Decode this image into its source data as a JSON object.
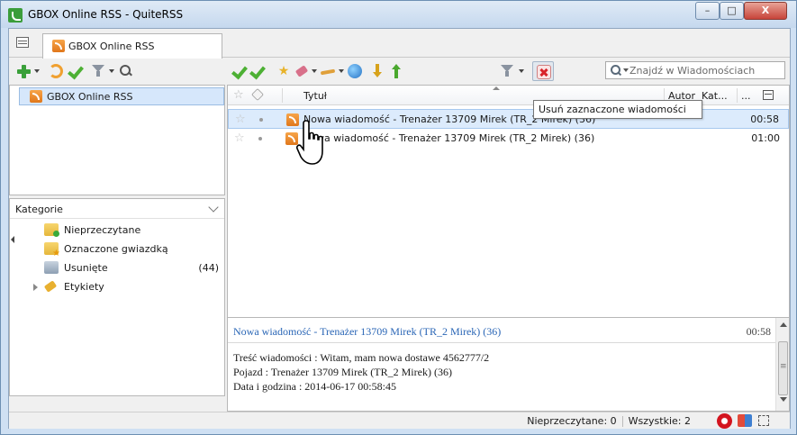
{
  "window": {
    "title": "GBOX Online RSS - QuiteRSS",
    "controls": {
      "minimize": "–",
      "maximize": "□",
      "close": "X"
    }
  },
  "tab": {
    "label": "GBOX Online RSS"
  },
  "search": {
    "placeholder": "Znajdź w Wiadomościach"
  },
  "feeds": {
    "items": [
      {
        "label": "GBOX Online RSS"
      }
    ]
  },
  "categories": {
    "header": "Kategorie",
    "items": [
      {
        "label": "Nieprzeczytane",
        "count": "",
        "icon": "folder-new-icon"
      },
      {
        "label": "Oznaczone gwiazdką",
        "count": "",
        "icon": "folder-star-icon"
      },
      {
        "label": "Usunięte",
        "count": "(44)",
        "icon": "recycle-bin-icon"
      },
      {
        "label": "Etykiety",
        "count": "",
        "icon": "label-icon"
      }
    ]
  },
  "news_list": {
    "columns": {
      "title": "Tytuł",
      "author": "Autor",
      "category": "Kat...",
      "more": "..."
    },
    "rows": [
      {
        "title": "Nowa wiadomość - Trenażer 13709 Mirek (TR_2 Mirek) (36)",
        "time": "00:58",
        "selected": true
      },
      {
        "title": "Nowa wiadomość - Trenażer 13709 Mirek (TR_2 Mirek) (36)",
        "time": "01:00",
        "selected": false
      }
    ],
    "tooltip": "Usuń zaznaczone wiadomości"
  },
  "preview": {
    "title": "Nowa wiadomość - Trenażer 13709 Mirek (TR_2 Mirek) (36)",
    "time": "00:58",
    "body": [
      "Treść wiadomości : Witam, mam nowa dostawe 4562777/2",
      "Pojazd : Trenażer 13709 Mirek (TR_2 Mirek) (36)",
      "Data i godzina : 2014-06-17 00:58:45"
    ]
  },
  "status": {
    "unread": "Nieprzeczytane: 0",
    "all": "Wszystkie: 2"
  },
  "colors": {
    "selection": "#dcebfc",
    "link": "#2a66b6",
    "accent_green": "#4db034",
    "delete_red": "#d8232a"
  }
}
